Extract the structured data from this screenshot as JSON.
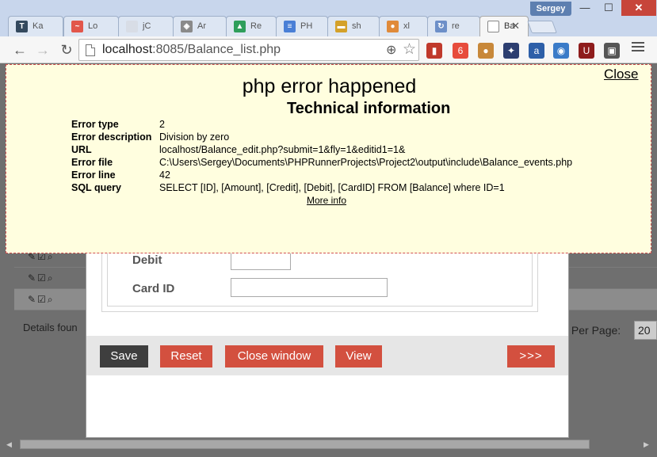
{
  "window": {
    "user": "Sergey",
    "minimize": "—",
    "maximize": "☐",
    "close": "✕"
  },
  "tabs": [
    {
      "label": "Ka",
      "icon": "T",
      "color": "#34495e"
    },
    {
      "label": "Lo",
      "icon": "~",
      "color": "#e2564b"
    },
    {
      "label": "jC",
      "icon": "",
      "color": "#d8dde6"
    },
    {
      "label": "Ar",
      "icon": "◈",
      "color": "#8a8a8a"
    },
    {
      "label": "Re",
      "icon": "▲",
      "color": "#2e9e5b"
    },
    {
      "label": "PH",
      "icon": "≡",
      "color": "#4a7fd6"
    },
    {
      "label": "sh",
      "icon": "▬",
      "color": "#d4a12a"
    },
    {
      "label": "xl",
      "icon": "●",
      "color": "#e08a3a"
    },
    {
      "label": "re",
      "icon": "↻",
      "color": "#6d8fc8"
    },
    {
      "label": "Ba",
      "icon": "",
      "color": "#ffffff"
    }
  ],
  "toolbar": {
    "url_host": "localhost",
    "url_rest": ":8085/Balance_list.php",
    "back": "←",
    "forward": "→",
    "reload": "↻",
    "zoom": "⊕",
    "star": "☆"
  },
  "extensions": [
    {
      "name": "book-extension-icon",
      "color": "#c0392b",
      "glyph": "▮"
    },
    {
      "name": "rocket-extension-icon",
      "color": "#e74c3c",
      "glyph": "6"
    },
    {
      "name": "cookie-extension-icon",
      "color": "#c8883a",
      "glyph": "●"
    },
    {
      "name": "spider-extension-icon",
      "color": "#2c3e70",
      "glyph": "✦"
    },
    {
      "name": "amazon-extension-icon",
      "color": "#2d5fa8",
      "glyph": "a"
    },
    {
      "name": "globe-extension-icon",
      "color": "#3a7bc8",
      "glyph": "◉"
    },
    {
      "name": "ublock-extension-icon",
      "color": "#8e1c1c",
      "glyph": "U"
    },
    {
      "name": "plug-extension-icon",
      "color": "#555555",
      "glyph": "▣"
    }
  ],
  "error": {
    "close_label": "Close",
    "title": "php error happened",
    "subtitle": "Technical information",
    "rows": [
      {
        "key": "Error type",
        "value": "2"
      },
      {
        "key": "Error description",
        "value": "Division by zero"
      },
      {
        "key": "URL",
        "value": "localhost/Balance_edit.php?submit=1&fly=1&editid1=1&"
      },
      {
        "key": "Error file",
        "value": "C:\\Users\\Sergey\\Documents\\PHPRunnerProjects\\Project2\\output\\include\\Balance_events.php"
      },
      {
        "key": "Error line",
        "value": "42"
      },
      {
        "key": "SQL query",
        "value": "SELECT [ID], [Amount], [Credit], [Debit], [CardID] FROM [Balance] where ID=1"
      }
    ],
    "more_info": "More info"
  },
  "form": {
    "debit_label": "Debit",
    "card_label": "Card ID",
    "debit_value": "",
    "card_value": ""
  },
  "buttons": {
    "save": "Save",
    "reset": "Reset",
    "close_window": "Close window",
    "view": "View",
    "next": ">>>"
  },
  "grid": {
    "row_icons": "✎☑⌕",
    "details_text": "Details foun",
    "per_page_label": "s Per Page:",
    "per_page_value": "20"
  }
}
